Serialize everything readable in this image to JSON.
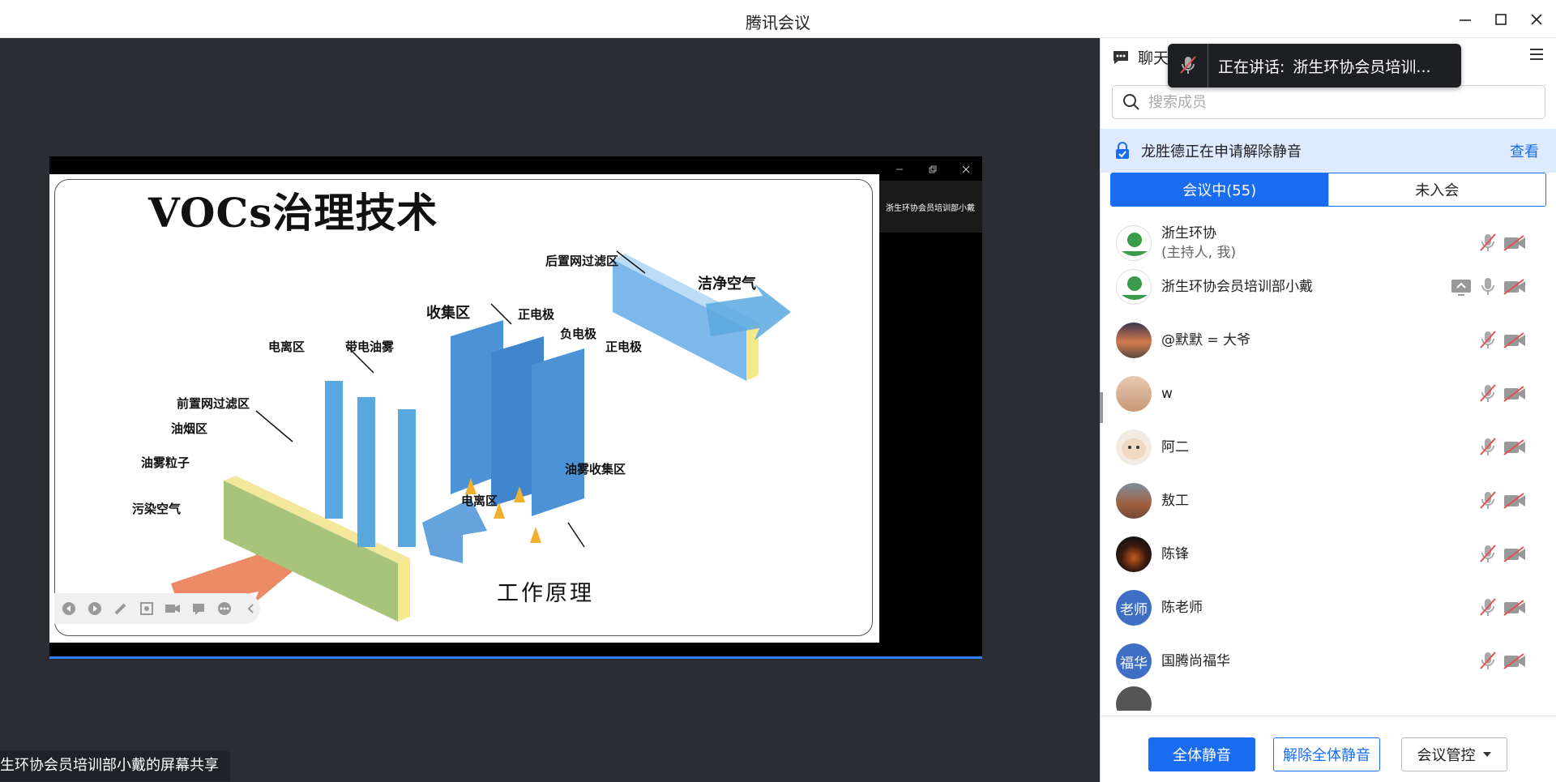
{
  "window": {
    "title": "腾讯会议"
  },
  "share": {
    "thumb_label": "浙生环协会员培训部小戴",
    "owner_label": "生环协会员培训部小戴的屏幕共享",
    "slide": {
      "title": "VOCs治理技术",
      "footer": "工作原理",
      "labels": {
        "rear_filter": "后置网过滤区",
        "clean_air": "洁净空气",
        "collect_zone": "收集区",
        "pos_electrode_1": "正电极",
        "neg_electrode": "负电极",
        "pos_electrode_2": "正电极",
        "ion_zone_top": "电离区",
        "charged_mist": "带电油雾",
        "front_filter": "前置网过滤区",
        "smoke_zone": "油烟区",
        "mist_particles": "油雾粒子",
        "polluted_air": "污染空气",
        "mist_collect": "油雾收集区",
        "ion_zone_bottom": "电离区"
      }
    }
  },
  "panel": {
    "chat_tab": "聊天",
    "speaking_prefix": "正在讲话:",
    "speaking_name": "浙生环协会员培训...",
    "search_placeholder": "搜索成员",
    "notice_text": "龙胜德正在申请解除静音",
    "notice_action": "查看",
    "tabs": {
      "in_meeting": "会议中(55)",
      "not_joined": "未入会"
    },
    "members": [
      {
        "name": "浙生环协",
        "sub": "(主持人, 我)"
      },
      {
        "name": "浙生环协会员培训部小戴",
        "sub": ""
      },
      {
        "name": "@默默 = 大爷",
        "sub": ""
      },
      {
        "name": "w",
        "sub": ""
      },
      {
        "name": "阿二",
        "sub": ""
      },
      {
        "name": "敖工",
        "sub": ""
      },
      {
        "name": "陈锋",
        "sub": ""
      },
      {
        "name": "陈老师",
        "sub": "",
        "avatar_text": "老师"
      },
      {
        "name": "国腾尚福华",
        "sub": "",
        "avatar_text": "福华"
      }
    ],
    "buttons": {
      "mute_all": "全体静音",
      "unmute_all": "解除全体静音",
      "control": "会议管控"
    }
  },
  "colors": {
    "accent": "#1a6cf0",
    "stage": "#2a2d31",
    "notice_bg": "#ddeaff"
  }
}
